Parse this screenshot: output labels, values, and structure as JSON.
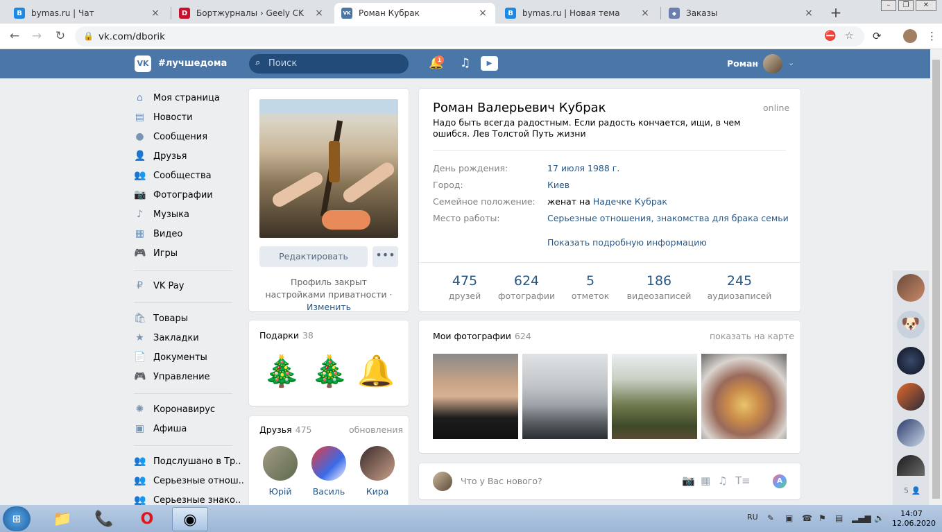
{
  "browser": {
    "tabs": [
      {
        "title": "bymas.ru | Чат",
        "icon": "B"
      },
      {
        "title": "Бортжурналы › Geely CK",
        "icon": "D"
      },
      {
        "title": "Роман Кубрак",
        "icon": "VK"
      },
      {
        "title": "bymas.ru | Новая тема",
        "icon": "B"
      },
      {
        "title": "Заказы",
        "icon": "shield"
      }
    ],
    "url": "vk.com/dborik",
    "new_tab": "+"
  },
  "header": {
    "logo": "VK",
    "hashtag": "#лучшедома",
    "search_placeholder": "Поиск",
    "notif_count": "1",
    "user_name": "Роман"
  },
  "menu": {
    "items": [
      "Моя страница",
      "Новости",
      "Сообщения",
      "Друзья",
      "Сообщества",
      "Фотографии",
      "Музыка",
      "Видео",
      "Игры"
    ],
    "pay": "VK Pay",
    "items2": [
      "Товары",
      "Закладки",
      "Документы",
      "Управление"
    ],
    "items3": [
      "Коронавирус",
      "Афиша"
    ],
    "items4": [
      "Подслушано в Тр..",
      "Серьезные отнош..",
      "Серьезные знако.."
    ]
  },
  "left_col": {
    "edit_label": "Редактировать",
    "more_label": "•••",
    "closed_text": "Профиль закрыт настройками приватности",
    "closed_sep": " · ",
    "change_link": "Изменить",
    "gifts_title": "Подарки",
    "gifts_count": "38",
    "friends_title": "Друзья",
    "friends_count": "475",
    "friends_updates": "обновления",
    "friends": [
      "Юрій",
      "Василь",
      "Кира"
    ]
  },
  "profile": {
    "name": "Роман Валерьевич Кубрак",
    "online": "online",
    "status": "Надо быть всегда радостным. Если радость кончается, ищи, в чем ошибся. Лев Толстой Путь жизни",
    "info": [
      {
        "label": "День рождения:",
        "value": "17 июля 1988 г."
      },
      {
        "label": "Город:",
        "value": "Киев"
      },
      {
        "label": "Семейное положение:",
        "value_prefix": "женат на",
        "value": "Надечке Кубрак"
      },
      {
        "label": "Место работы:",
        "value": "Серьезные отношения, знакомства для брака семьи"
      }
    ],
    "show_more": "Показать подробную информацию",
    "counters": [
      {
        "num": "475",
        "label": "друзей"
      },
      {
        "num": "624",
        "label": "фотографии"
      },
      {
        "num": "5",
        "label": "отметок"
      },
      {
        "num": "186",
        "label": "видеозаписей"
      },
      {
        "num": "245",
        "label": "аудиозаписей"
      }
    ]
  },
  "photos": {
    "title": "Мои фотографии",
    "count": "624",
    "map_link": "показать на карте"
  },
  "composer": {
    "placeholder": "Что у Вас нового?"
  },
  "chats": {
    "count": "5"
  },
  "taskbar": {
    "lang": "RU",
    "time": "14:07",
    "date": "12.06.2020"
  },
  "colors": {
    "vk_blue": "#4a76a8",
    "link": "#2a5885"
  }
}
